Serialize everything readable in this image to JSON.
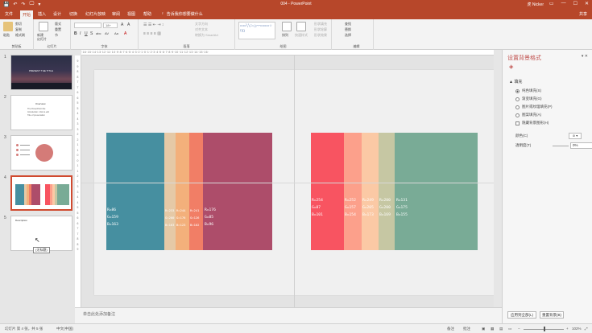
{
  "titlebar": {
    "title": "004 - PowerPoint",
    "user": "虎 Nicker",
    "qat": [
      "💾",
      "↶",
      "↷",
      "🖵",
      "▾"
    ],
    "window_controls": [
      "▭",
      "—",
      "☐",
      "✕"
    ]
  },
  "tabs": {
    "items": [
      "文件",
      "开始",
      "插入",
      "设计",
      "切换",
      "幻灯片放映",
      "审阅",
      "视图",
      "帮助"
    ],
    "active": "开始",
    "tell_me": "告诉我你想要做什么",
    "share": "共享"
  },
  "ribbon": {
    "clipboard": {
      "paste": "粘贴",
      "cut": "剪切",
      "copy": "复制",
      "format_painter": "格式刷",
      "label": "剪贴板"
    },
    "slides": {
      "new_slide": "新建\n幻灯片",
      "layout": "版式",
      "reset": "重置",
      "section": "节",
      "label": "幻灯片"
    },
    "font": {
      "font_size": "18+",
      "bold": "B",
      "italic": "I",
      "underline": "U",
      "strike": "S",
      "shadow": "abc",
      "spacing": "AV",
      "case": "Aa",
      "color": "A",
      "label": "字体"
    },
    "paragraph": {
      "text_direction": "文字方向",
      "align_text": "对齐文本",
      "smartart": "转换为 SmartArt",
      "label": "段落"
    },
    "drawing": {
      "arrange": "排列",
      "quick_styles": "快速样式",
      "shape_fill": "形状填充",
      "shape_outline": "形状轮廓",
      "shape_effects": "形状效果",
      "label": "绘图"
    },
    "editing": {
      "find": "查找",
      "replace": "替换",
      "select": "选择",
      "label": "编辑"
    },
    "shapes_sample": "▭▭╲╲□○△⌐⌐▭▭▭☆⟨⟩{}"
  },
  "thumbnails": [
    {
      "num": "1",
      "text": "PRESENT THE TITLE"
    },
    {
      "num": "2",
      "title": "Overview",
      "lines": [
        "The PowerPoint title",
        "Introduction: click to edit",
        "Title of presentation"
      ]
    },
    {
      "num": "3"
    },
    {
      "num": "4"
    },
    {
      "num": "5",
      "title": "Description"
    }
  ],
  "tooltip": "(无标题)",
  "ruler": {
    "h": "·16·15·14·13·12·11·10·9·8·7·6·5·4·3·2·1·0·1·2·3·4·5·6·7·8·9·10·11·12·13·14·15·16·",
    "v": [
      "9",
      "8",
      "7",
      "6",
      "5",
      "4",
      "3",
      "2",
      "1",
      "0",
      "1",
      "2",
      "3",
      "4",
      "5",
      "6",
      "7",
      "8",
      "9"
    ]
  },
  "palette_left": {
    "stripes": [
      {
        "color": "#468fa0",
        "lines": [
          "R=86",
          "G=159",
          "B=163"
        ]
      },
      {
        "color": "#e5c9a6",
        "lines": [
          "R=233",
          "G=200",
          "B=163"
        ]
      },
      {
        "color": "#f3b07b",
        "lines": [
          "R=244",
          "G=176",
          "B=123"
        ]
      },
      {
        "color": "#f17e66",
        "lines": [
          "R=241",
          "G=126",
          "B=102"
        ]
      },
      {
        "color": "#ad4d6a",
        "lines": [
          "R=176",
          "G=85",
          "B=96"
        ]
      }
    ]
  },
  "palette_right": {
    "stripes": [
      {
        "color": "#f85461",
        "lines": [
          "R=254",
          "G=87",
          "B=101"
        ]
      },
      {
        "color": "#fca08b",
        "lines": [
          "R=252",
          "G=157",
          "B=154"
        ]
      },
      {
        "color": "#fbc9a5",
        "lines": [
          "R=249",
          "G=205",
          "B=173"
        ]
      },
      {
        "color": "#c6c7a3",
        "lines": [
          "R=200",
          "G=200",
          "B=169"
        ]
      },
      {
        "color": "#79ab96",
        "lines": [
          "R=131",
          "G=175",
          "B=155"
        ]
      }
    ]
  },
  "pane": {
    "title": "设置背景格式",
    "controls": "▾ ✕",
    "fill_header": "▲ 填充",
    "options": [
      {
        "label": "纯色填充(S)",
        "type": "radio",
        "checked": true
      },
      {
        "label": "渐变填充(G)",
        "type": "radio",
        "checked": false
      },
      {
        "label": "图片或纹理填充(P)",
        "type": "radio",
        "checked": false
      },
      {
        "label": "图案填充(A)",
        "type": "radio",
        "checked": false
      },
      {
        "label": "隐藏背景图形(H)",
        "type": "checkbox",
        "checked": false
      }
    ],
    "color_label": "颜色(C)",
    "color_btn": "⊘ ▾",
    "transparency_label": "透明度(T)",
    "transparency_value": "0%",
    "apply_all": "应用到全部(L)",
    "reset_bg": "重置背景(B)"
  },
  "notes_placeholder": "单击此处添加备注",
  "status": {
    "slide": "幻灯片 第 4 张，共 5 张",
    "lang": "中文(中国)",
    "notes": "备注",
    "comments": "批注",
    "zoom": "102%"
  }
}
